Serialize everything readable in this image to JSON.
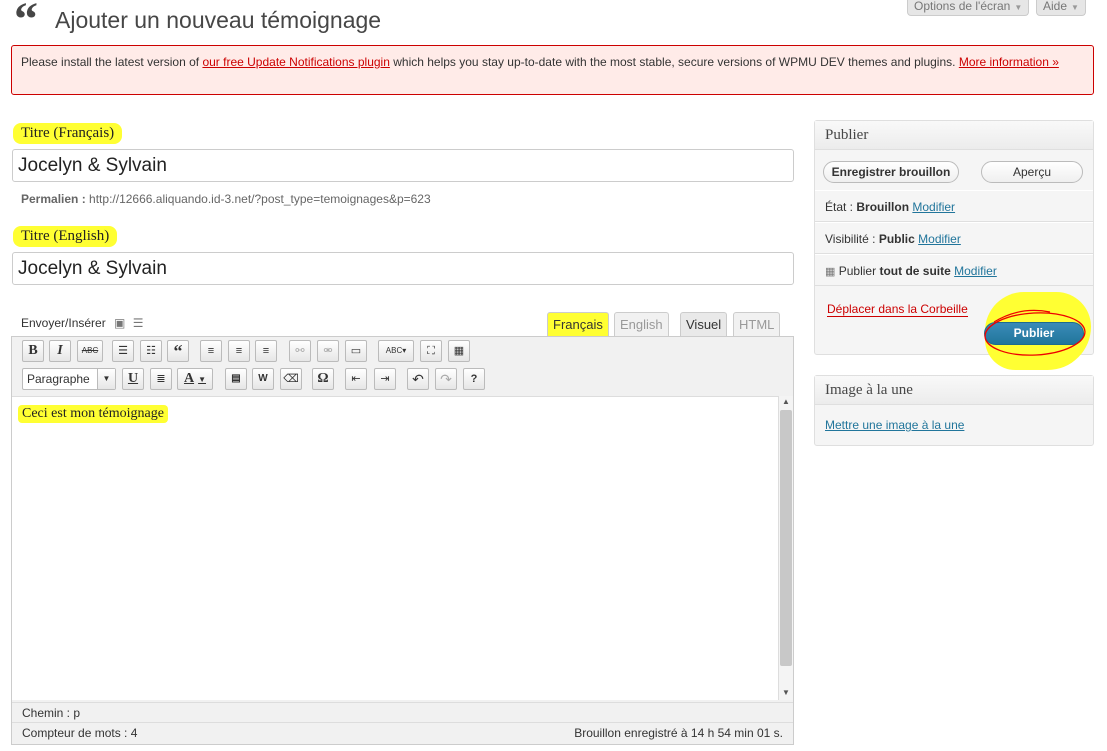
{
  "header": {
    "title_icon": "quote-icon",
    "title": "Ajouter un nouveau témoignage",
    "screen_options": "Options de l'écran",
    "help": "Aide"
  },
  "notice": {
    "text_before": "Please install the latest version of ",
    "link": "our free Update Notifications plugin",
    "text_after": " which helps you stay up-to-date with the most stable, secure versions of WPMU DEV themes and plugins. ",
    "more": "More information »"
  },
  "title_fr": {
    "label": "Titre (Français)",
    "value": "Jocelyn & Sylvain"
  },
  "permalink": {
    "label": "Permalien :",
    "url": "http://12666.aliquando.id-3.net/?post_type=temoignages&p=623"
  },
  "title_en": {
    "label": "Titre (English)",
    "value": "Jocelyn & Sylvain"
  },
  "editor": {
    "upload_label": "Envoyer/Insérer",
    "lang_tabs": [
      "Français",
      "English"
    ],
    "mode_tabs": [
      "Visuel",
      "HTML"
    ],
    "format_select": "Paragraphe",
    "content": "Ceci est mon témoignage",
    "path_label": "Chemin :",
    "path_value": "p",
    "word_count": "Compteur de mots : 4",
    "autosave": "Brouillon enregistré à 14 h 54 min 01 s."
  },
  "toolbar1": [
    {
      "name": "bold-button",
      "glyph": "B"
    },
    {
      "name": "italic-button",
      "glyph": "I"
    },
    {
      "name": "strikethrough-button",
      "glyph": "ABC"
    },
    {
      "name": "bullet-list-button",
      "glyph": "☰"
    },
    {
      "name": "numbered-list-button",
      "glyph": "☷"
    },
    {
      "name": "blockquote-button",
      "glyph": "“"
    },
    {
      "name": "align-left-button",
      "glyph": "≡"
    },
    {
      "name": "align-center-button",
      "glyph": "≡"
    },
    {
      "name": "align-right-button",
      "glyph": "≡"
    },
    {
      "name": "link-button",
      "glyph": "⛓"
    },
    {
      "name": "unlink-button",
      "glyph": "⛓"
    },
    {
      "name": "more-tag-button",
      "glyph": "▭"
    },
    {
      "name": "spellcheck-button",
      "glyph": "ABC"
    },
    {
      "name": "fullscreen-button",
      "glyph": "⛶"
    },
    {
      "name": "kitchen-sink-button",
      "glyph": "▦"
    }
  ],
  "toolbar2": [
    {
      "name": "underline-button",
      "glyph": "U"
    },
    {
      "name": "justify-button",
      "glyph": "≣"
    },
    {
      "name": "text-color-button",
      "glyph": "A"
    },
    {
      "name": "paste-text-button",
      "glyph": "T"
    },
    {
      "name": "paste-word-button",
      "glyph": "W"
    },
    {
      "name": "clear-formatting-button",
      "glyph": "⌫"
    },
    {
      "name": "special-char-button",
      "glyph": "Ω"
    },
    {
      "name": "outdent-button",
      "glyph": "⇤"
    },
    {
      "name": "indent-button",
      "glyph": "⇥"
    },
    {
      "name": "undo-button",
      "glyph": "↶"
    },
    {
      "name": "redo-button",
      "glyph": "↷"
    },
    {
      "name": "help-button",
      "glyph": "?"
    }
  ],
  "publish": {
    "title": "Publier",
    "save_draft": "Enregistrer brouillon",
    "preview": "Aperçu",
    "status_label": "État :",
    "status_value": "Brouillon",
    "visibility_label": "Visibilité :",
    "visibility_value": "Public",
    "schedule_label": "Publier",
    "schedule_value": "tout de suite",
    "edit": "Modifier",
    "trash": "Déplacer dans la Corbeille",
    "publish_btn": "Publier"
  },
  "featured_image": {
    "title": "Image à la une",
    "link": "Mettre une image à la une"
  }
}
